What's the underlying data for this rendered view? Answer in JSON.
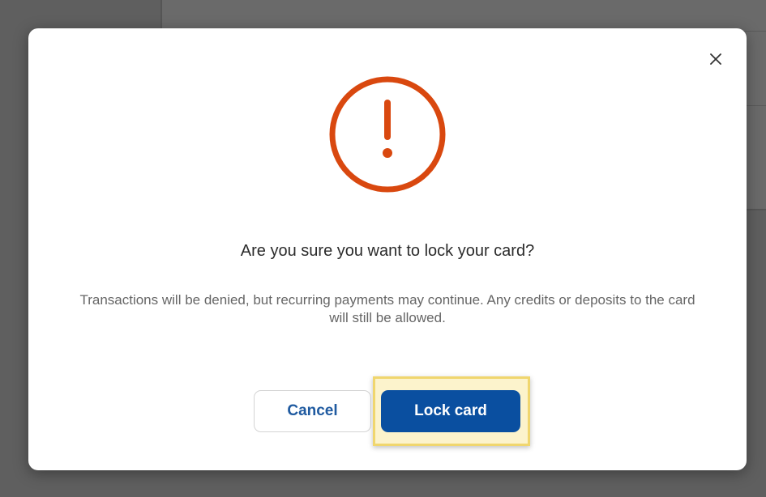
{
  "dialog": {
    "title": "Are you sure you want to lock your card?",
    "description": "Transactions will be denied, but recurring payments may continue. Any credits or deposits to the card will still be allowed.",
    "icon": "alert-exclamation-icon",
    "close_icon": "close-icon",
    "buttons": {
      "cancel_label": "Cancel",
      "lock_label": "Lock card"
    }
  },
  "colors": {
    "alert": "#d9480f",
    "primary": "#0a4fa0",
    "highlight": "#f0d66e"
  }
}
